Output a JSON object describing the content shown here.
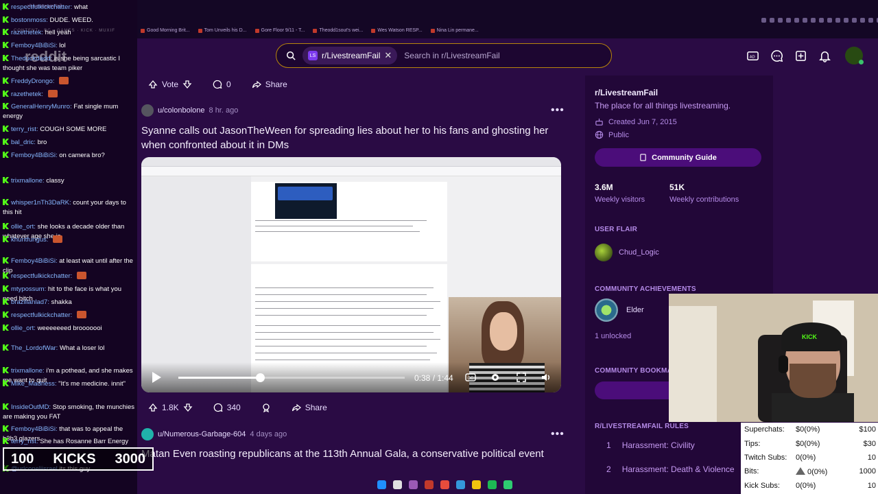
{
  "browser": {
    "tab_title": "r/LivestreamFail",
    "bookmarks": [
      "Good Morning Brit...",
      "Tom Unveils his D...",
      "Gore Floor 9/11 - T...",
      "Theodd1sout's wei...",
      "Wes Watson RESP...",
      "Nina Lin permane..."
    ]
  },
  "header": {
    "logo": "reddit",
    "search_chip": "r/LivestreamFail",
    "search_placeholder": "Search in r/LivestreamFail",
    "icons": [
      "ads-icon",
      "chat-icon",
      "create-icon",
      "notification-icon"
    ]
  },
  "post1": {
    "vote_label": "Vote",
    "comments": "0",
    "share": "Share",
    "username": "u/colonbolone",
    "time": "8 hr. ago",
    "title": "Syanne calls out JasonTheWeen for spreading lies about her to his fans and ghosting her when confronted about it in DMs",
    "video_time": "0:38 / 1:44",
    "video_progress": 0.36,
    "upvotes": "1.8K",
    "comment_count": "340",
    "share2": "Share"
  },
  "post2": {
    "username": "u/Numerous-Garbage-604",
    "time": "4 days ago",
    "title": "Matan Even roasting republicans at the 113th Annual Gala, a conservative political event"
  },
  "sidebar": {
    "name": "r/LivestreamFail",
    "description": "The place for all things livestreaming.",
    "created": "Created Jun 7, 2015",
    "visibility": "Public",
    "guide_button": "Community Guide",
    "visitors_num": "3.6M",
    "visitors_label": "Weekly visitors",
    "contrib_num": "51K",
    "contrib_label": "Weekly contributions",
    "user_flair_head": "USER FLAIR",
    "flair_name": "Chud_Logic",
    "achievements_head": "COMMUNITY ACHIEVEMENTS",
    "achievement_name": "Elder",
    "unlocked": "1 unlocked",
    "bookmarks_head": "COMMUNITY BOOKMA",
    "rules_head": "R/LIVESTREAMFAIL RULES",
    "rules": [
      {
        "num": "1",
        "text": "Harassment: Civility"
      },
      {
        "num": "2",
        "text": "Harassment: Death & Violence"
      }
    ]
  },
  "chat": [
    {
      "user": "respectfulkickchatter:",
      "text": "what",
      "emote": false
    },
    {
      "user": "bostonmoss:",
      "text": "DUDE. WEED.",
      "emote": false
    },
    {
      "user": "razethetek:",
      "text": "hell yeah",
      "emote": false
    },
    {
      "user": "Femboy4BiBiSi:",
      "text": "lol",
      "emote": false
    },
    {
      "user": "Theduckdadd:",
      "text": "is she being sarcastic I thought she was team piker",
      "emote": false
    },
    {
      "user": "FreddyDrongo:",
      "text": "",
      "emote": true
    },
    {
      "user": "razethetek:",
      "text": "",
      "emote": true
    },
    {
      "user": "GeneralHenryMunro:",
      "text": "Fat single mum energy",
      "emote": false
    },
    {
      "user": "terry_rist:",
      "text": "COUGH SOME MORE",
      "emote": false
    },
    {
      "user": "bal_dric:",
      "text": "bro",
      "emote": false
    },
    {
      "user": "Femboy4BiBiSi:",
      "text": "on camera bro?",
      "emote": false
    },
    {
      "user": "trixmallone:",
      "text": "classy",
      "emote": false
    },
    {
      "user": "whisper1nTh3DaRK:",
      "text": "count your days to this hit",
      "emote": false
    },
    {
      "user": "ollie_ort:",
      "text": "she looks a decade older than whatever age she is",
      "emote": false
    },
    {
      "user": "khuntfungus:",
      "text": "",
      "emote": true
    },
    {
      "user": "Femboy4BiBiSi:",
      "text": "at least wait until after the clip",
      "emote": false
    },
    {
      "user": "respectfulkickchatter:",
      "text": "",
      "emote": true
    },
    {
      "user": "mtypossum:",
      "text": "hit to the face is what you need bitch",
      "emote": false
    },
    {
      "user": "brazilianlad7:",
      "text": "shakka",
      "emote": false
    },
    {
      "user": "respectfulkickchatter:",
      "text": "",
      "emote": true
    },
    {
      "user": "ollie_ort:",
      "text": "weeeeeeed brooooooi",
      "emote": false
    },
    {
      "user": "The_LordofWar:",
      "text": "What a loser lol",
      "emote": false
    },
    {
      "user": "trixmallone:",
      "text": "i'm a pothead, and she makes me want to quit",
      "emote": false
    },
    {
      "user": "Mike_Madness:",
      "text": "\"It's me medicine. innit\"",
      "emote": false
    },
    {
      "user": "InsideOutMD:",
      "text": "Stop smoking, the munchies are making you FAT",
      "emote": false
    },
    {
      "user": "Femboy4BiBiSi:",
      "text": "that was to appeal the h3h3 glazers",
      "emote": false
    },
    {
      "user": "terry_rist:",
      "text": "She has Rosanne Barr Energy",
      "emote": false
    },
    {
      "user": "@urlconeliisrael",
      "text": "its this guy",
      "emote": false
    }
  ],
  "kick_goal": {
    "current": "100",
    "label": "KICKS",
    "target": "3000"
  },
  "stream_stats": [
    {
      "label": "Superchats:",
      "value": "$0(0%)",
      "goal": "$100"
    },
    {
      "label": "Tips:",
      "value": "$0(0%)",
      "goal": "$30"
    },
    {
      "label": "Twitch Subs:",
      "value": "0(0%)",
      "goal": "10"
    },
    {
      "label": "Bits:",
      "value": "0(0%)",
      "goal": "1000"
    },
    {
      "label": "Kick Subs:",
      "value": "0(0%)",
      "goal": "10"
    }
  ],
  "webcam_cap_text": "KICK"
}
